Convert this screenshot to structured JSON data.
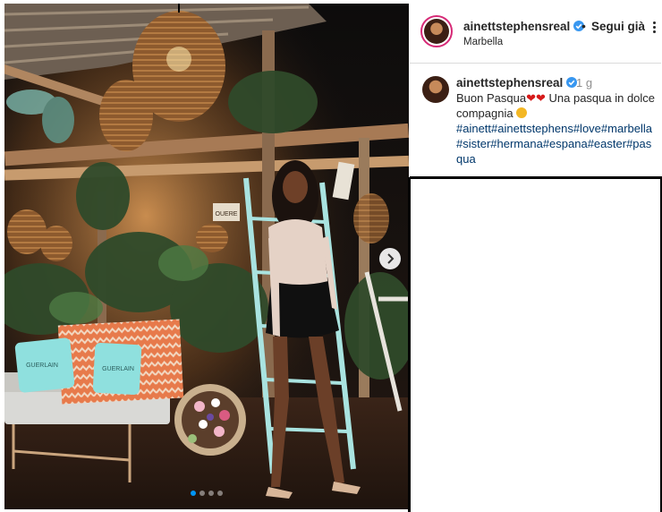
{
  "header": {
    "username": "ainettstephensreal",
    "follow_label": "Segui già",
    "location": "Marbella"
  },
  "caption": {
    "username": "ainettstephensreal",
    "time": "1 g",
    "text_part1": "Buon Pasqua",
    "text_part2": " Una pasqua in dolce compagnia ",
    "hashtags": "#ainett#ainettstephens#love#marbella#sister#hermana#espana#easter#pasqua"
  },
  "photo": {
    "sign_text_1": "OUERE",
    "cushion_brand_1": "GUERLAIN",
    "cushion_brand_2": "GUERLAIN",
    "carousel_count": 4,
    "carousel_active": 1
  },
  "icons": {
    "verified": "verified-badge-icon",
    "next": "chevron-right-icon",
    "more": "more-options-icon",
    "heart": "red-heart-emoji",
    "smile": "smiling-hearts-emoji"
  },
  "colors": {
    "verified_blue": "#3897f0",
    "hashtag_blue": "#00376b",
    "story_ring": "#d62976",
    "heart_red": "#d61a1a",
    "carousel_active": "#0095f6"
  }
}
